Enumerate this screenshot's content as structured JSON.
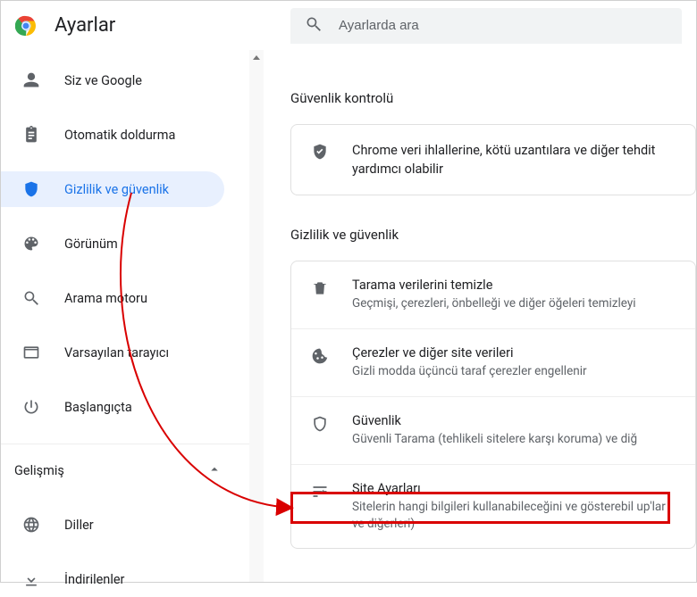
{
  "header": {
    "app_title": "Ayarlar",
    "search_placeholder": "Ayarlarda ara"
  },
  "sidebar": {
    "items": [
      {
        "id": "you-and-google",
        "label": "Siz ve Google",
        "active": false
      },
      {
        "id": "autofill",
        "label": "Otomatik doldurma",
        "active": false
      },
      {
        "id": "privacy",
        "label": "Gizlilik ve güvenlik",
        "active": true
      },
      {
        "id": "appearance",
        "label": "Görünüm",
        "active": false
      },
      {
        "id": "search-engine",
        "label": "Arama motoru",
        "active": false
      },
      {
        "id": "default-browser",
        "label": "Varsayılan tarayıcı",
        "active": false
      },
      {
        "id": "on-startup",
        "label": "Başlangıçta",
        "active": false
      }
    ],
    "advanced_label": "Gelişmiş",
    "advanced_items": [
      {
        "id": "languages",
        "label": "Diller"
      },
      {
        "id": "downloads",
        "label": "İndirilenler"
      }
    ]
  },
  "main": {
    "safety_section_title": "Güvenlik kontrolü",
    "safety_card_text": "Chrome veri ihlallerine, kötü uzantılara ve diğer tehdit yardımcı olabilir",
    "privacy_section_title": "Gizlilik ve güvenlik",
    "privacy_rows": [
      {
        "id": "clear-data",
        "title": "Tarama verilerini temizle",
        "sub": "Geçmişi, çerezleri, önbelleği ve diğer öğeleri temizleyi"
      },
      {
        "id": "cookies",
        "title": "Çerezler ve diğer site verileri",
        "sub": "Gizli modda üçüncü taraf çerezler engellenir"
      },
      {
        "id": "security",
        "title": "Güvenlik",
        "sub": "Güvenli Tarama (tehlikeli sitelere karşı koruma) ve diğ"
      },
      {
        "id": "site-settings",
        "title": "Site Ayarları",
        "sub": "Sitelerin hangi bilgileri kullanabileceğini ve gösterebil up'lar ve diğerleri)"
      }
    ]
  },
  "annotation": {
    "highlight_target": "site-settings"
  }
}
